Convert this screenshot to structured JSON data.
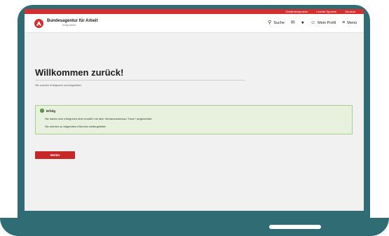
{
  "utility_bar": {
    "items": [
      "Gebärdensprache",
      "Leichte Sprache",
      "Deutsch"
    ]
  },
  "header": {
    "brand_name": "Bundesagentur für Arbeit",
    "brand_claim": "bringt weiter",
    "search_label": "Suche",
    "profile_label": "Mein Profil",
    "menu_label": "Menü",
    "icons": [
      "search-icon",
      "mail-icon",
      "bell-icon",
      "user-icon",
      "menu-icon"
    ]
  },
  "main": {
    "title": "Willkommen zurück!",
    "subtitle": "Sie wurden erfolgreich zurückgeleitet.",
    "success": {
      "title": "Erfolg",
      "line1": "Sie haben sich erfolgreich über bundID mit dem Vertrauensniveau \"Hoch\" angemeldet.",
      "line2": "Sie werden zu folgendem eService weitergeleitet:"
    },
    "button_label": "Weiter"
  },
  "colors": {
    "brand_red": "#d32f2f",
    "frame_teal": "#2f6c73",
    "success_bg": "#e7f1dd",
    "success_border": "#a9cf8d"
  }
}
